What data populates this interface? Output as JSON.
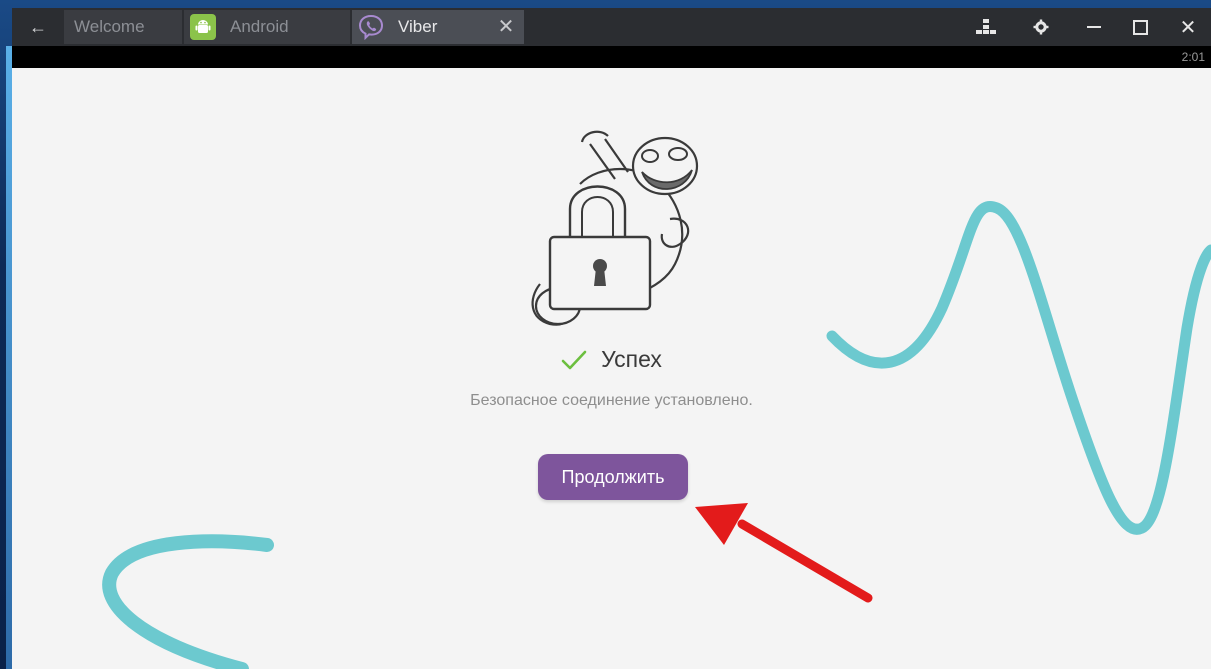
{
  "tabs": [
    {
      "label": "Welcome"
    },
    {
      "label": "Android"
    },
    {
      "label": "Viber"
    }
  ],
  "status": {
    "clock": "2:01"
  },
  "main": {
    "success_title": "Успех",
    "subtitle": "Безопасное соединение установлено.",
    "continue_label": "Продолжить"
  },
  "colors": {
    "accent": "#7e559c",
    "wave": "#6cc9cf",
    "check": "#6cbf3f",
    "arrow": "#e31b1b"
  },
  "icons": {
    "back": "back-arrow-icon",
    "android": "android-icon",
    "viber": "viber-icon",
    "close": "close-icon",
    "keymap": "keyboard-map-icon",
    "settings": "gear-icon",
    "minimize": "minimize-icon",
    "maximize": "maximize-icon",
    "exit": "close-window-icon"
  }
}
